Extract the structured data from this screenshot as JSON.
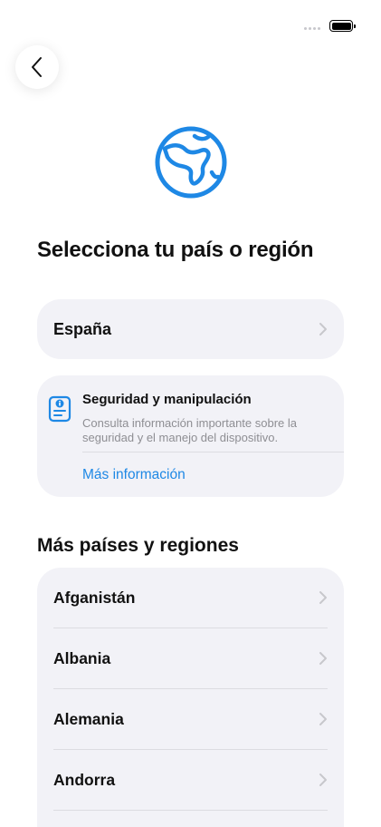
{
  "header": {
    "back_icon": "chevron-left-icon",
    "hero_icon": "globe-icon"
  },
  "title": "Selecciona tu país o región",
  "selected": {
    "label": "España"
  },
  "info": {
    "icon": "info-document-icon",
    "title": "Seguridad y manipulación",
    "description": "Consulta información importante sobre la seguridad y el manejo del dispositivo.",
    "link": "Más información"
  },
  "more": {
    "title": "Más países y regiones",
    "items": [
      {
        "label": "Afganistán"
      },
      {
        "label": "Albania"
      },
      {
        "label": "Alemania"
      },
      {
        "label": "Andorra"
      }
    ]
  },
  "colors": {
    "accent": "#1e88e5",
    "card": "#f2f2f7"
  }
}
